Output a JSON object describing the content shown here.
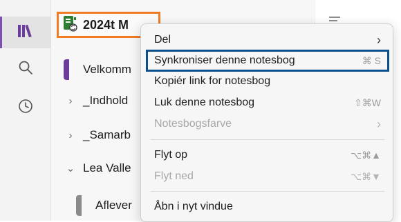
{
  "rail": {
    "items": [
      {
        "name": "notebooks",
        "icon": "notebooks-icon",
        "active": true
      },
      {
        "name": "search",
        "icon": "search-icon",
        "active": false
      },
      {
        "name": "recent",
        "icon": "clock-icon",
        "active": false
      }
    ],
    "accent_color": "#7a4fb0"
  },
  "notebook": {
    "title": "2024t M",
    "icon": "notebook-sync-icon",
    "icon_color": "#2e7d32",
    "highlight_color": "#f07b22"
  },
  "tree": [
    {
      "label": "Velkomm",
      "type": "section",
      "color": "#6a3d9a"
    },
    {
      "label": "_Indhold",
      "type": "group",
      "expanded": false
    },
    {
      "label": "_Samarb",
      "type": "group",
      "expanded": false
    },
    {
      "label": "Lea Valle",
      "type": "group",
      "expanded": true
    },
    {
      "label": "Aflever",
      "type": "section",
      "color": "#8a8a8a"
    }
  ],
  "context_menu": {
    "highlight_color": "#0b4f8c",
    "items": [
      {
        "label": "Del",
        "shortcut": "",
        "submenu": true,
        "disabled": false
      },
      {
        "label": "Synkroniser denne notesbog",
        "shortcut": "⌘ S",
        "submenu": false,
        "disabled": false,
        "highlighted": true
      },
      {
        "label": "Kopiér link for notesbog",
        "shortcut": "",
        "submenu": false,
        "disabled": false
      },
      {
        "label": "Luk denne notesbog",
        "shortcut": "⇧⌘W",
        "submenu": false,
        "disabled": false
      },
      {
        "label": "Notesbogsfarve",
        "shortcut": "",
        "submenu": true,
        "disabled": true
      },
      {
        "label": "Flyt op",
        "shortcut": "⌥⌘▲",
        "submenu": false,
        "disabled": false
      },
      {
        "label": "Flyt ned",
        "shortcut": "⌥⌘▼",
        "submenu": false,
        "disabled": true
      },
      {
        "label": "Åbn i nyt vindue",
        "shortcut": "",
        "submenu": false,
        "disabled": false
      }
    ]
  }
}
